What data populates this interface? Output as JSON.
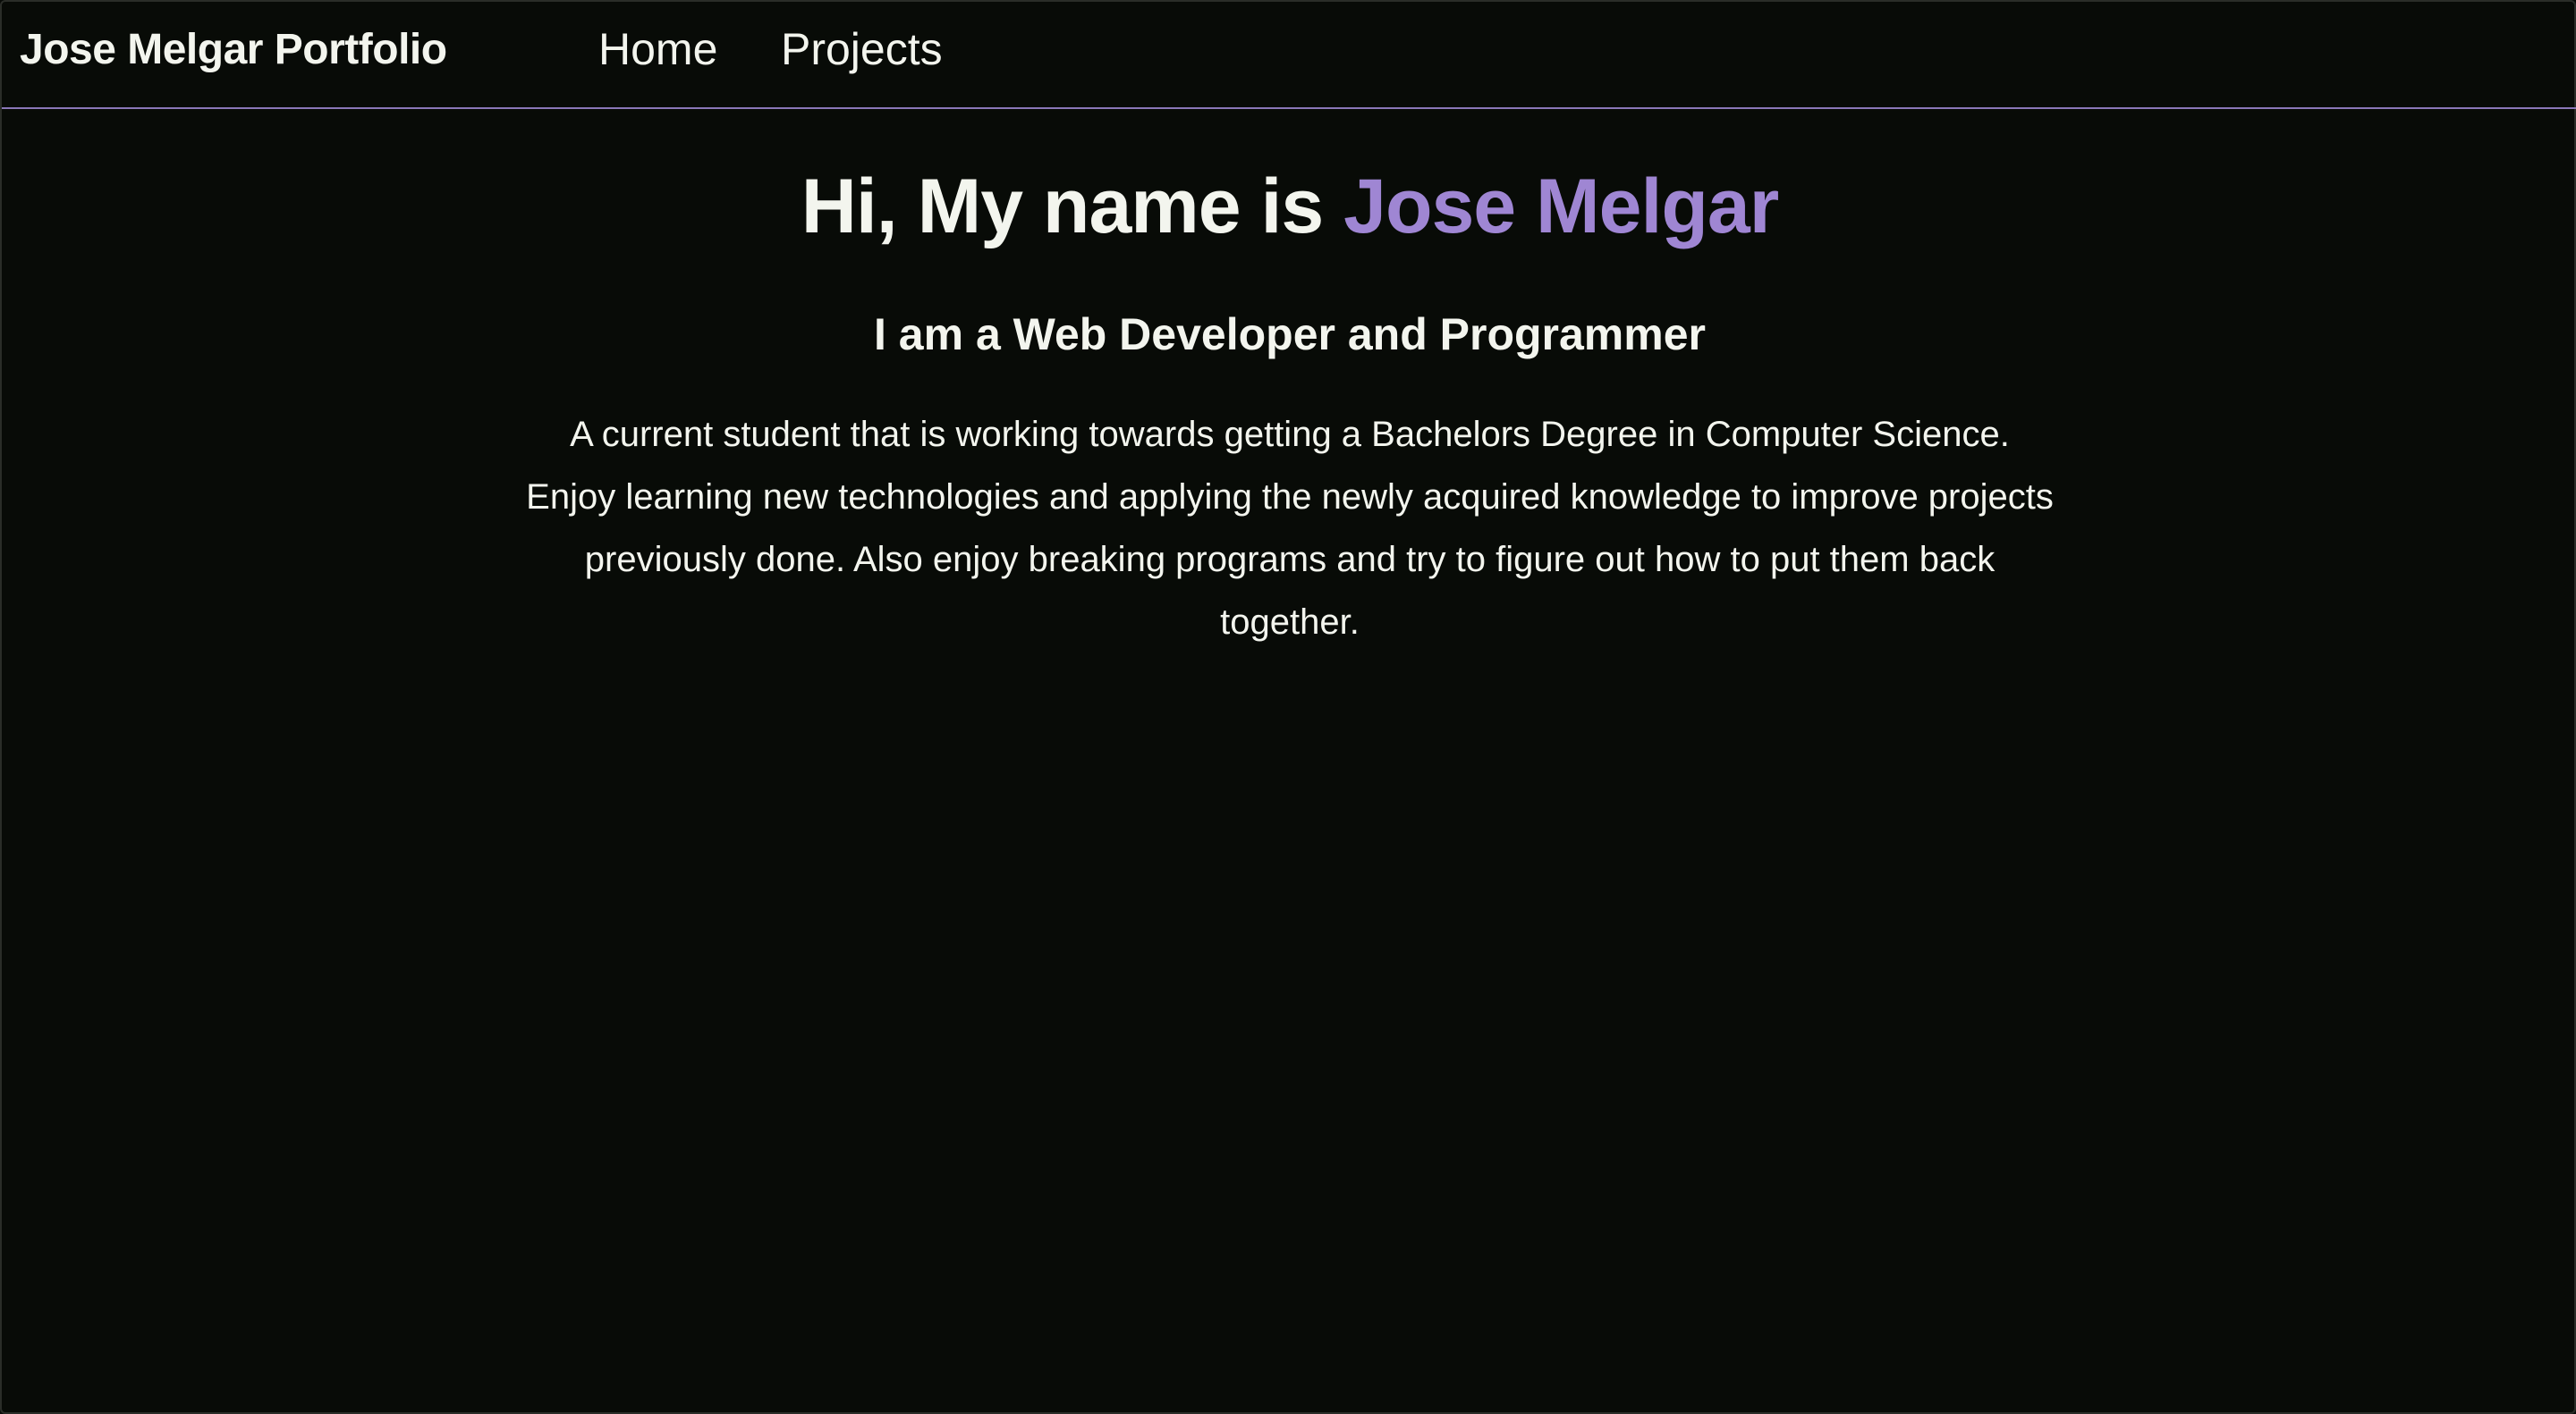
{
  "nav": {
    "brand": "Jose Melgar Portfolio",
    "links": [
      {
        "label": "Home"
      },
      {
        "label": "Projects"
      }
    ]
  },
  "hero": {
    "title_prefix": "Hi, My name is ",
    "title_name": "Jose Melgar",
    "subtitle": "I am a Web Developer and Programmer",
    "bio": "A current student that is working towards getting a Bachelors Degree in Computer Science. Enjoy learning new technologies and applying the newly acquired knowledge to improve projects previously done. Also enjoy breaking programs and try to figure out how to put them back together."
  },
  "colors": {
    "background": "#080b07",
    "text": "#f3f5ee",
    "accent": "#9f86d3",
    "nav_border": "#8a77b8"
  }
}
